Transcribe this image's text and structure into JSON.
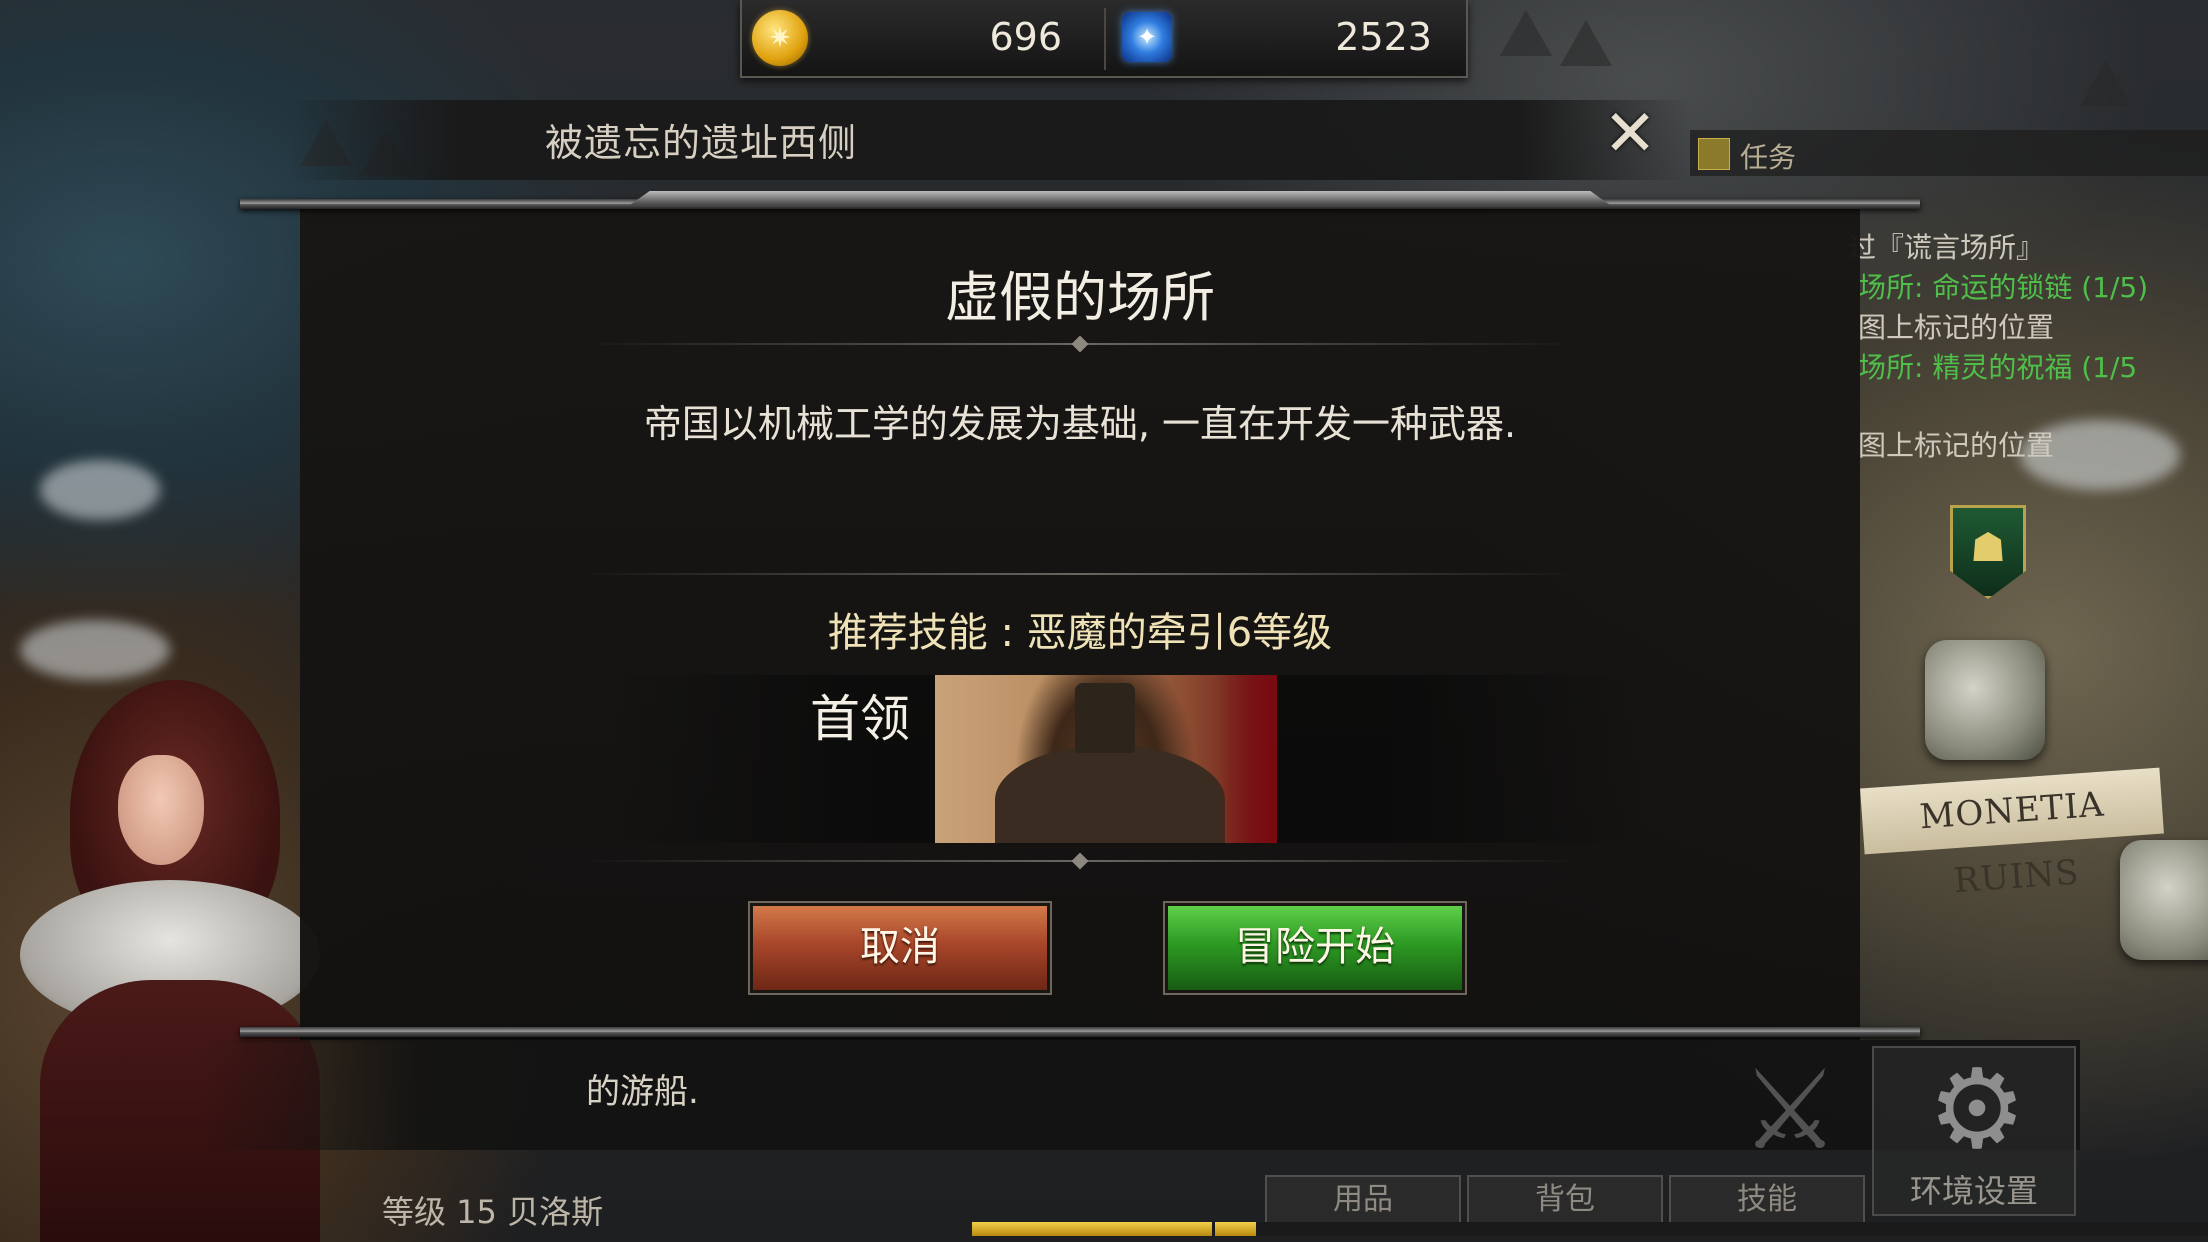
{
  "currency": {
    "gold": "696",
    "gems": "2523",
    "gold_icon": "gold-coin-icon",
    "gem_icon": "blue-gem-icon"
  },
  "location": {
    "title": "被遗忘的遗址西侧",
    "close_icon": "✕"
  },
  "quest_panel": {
    "title": "任务",
    "lines": [
      {
        "text": "过『谎言场所』",
        "color": "#cfc9bd"
      },
      {
        "text": "场所: 命运的锁链 (1/5)",
        "color": "#4fbf4a"
      },
      {
        "text": "图上标记的位置",
        "color": "#cfc9bd"
      },
      {
        "text": "场所: 精灵的祝福 (1/5",
        "color": "#4fbf4a"
      },
      {
        "text": "图上标记的位置",
        "color": "#cfc9bd"
      }
    ]
  },
  "map": {
    "label": "MONETIA RUINS"
  },
  "modal": {
    "title": "虚假的场所",
    "description": "帝国以机械工学的发展为基础, 一直在开发一种武器.",
    "recommend": "推荐技能 : 恶魔的牵引6等级",
    "boss_label": "首领",
    "cancel_label": "取消",
    "start_label": "冒险开始"
  },
  "dialogue": {
    "text": "的游船."
  },
  "menu": {
    "skill_icon": "sword-icon",
    "settings_label": "环境设置",
    "settings_icon": "⚙",
    "tabs": [
      "用品",
      "背包",
      "技能"
    ]
  },
  "player": {
    "info": "等级 15 贝洛斯",
    "xp_progress": 0.23
  },
  "colors": {
    "gold": "#e0a10e",
    "gem": "#2f7de0",
    "cancel": "#a8462a",
    "start": "#2d9a23",
    "quest_green": "#4fbf4a"
  }
}
